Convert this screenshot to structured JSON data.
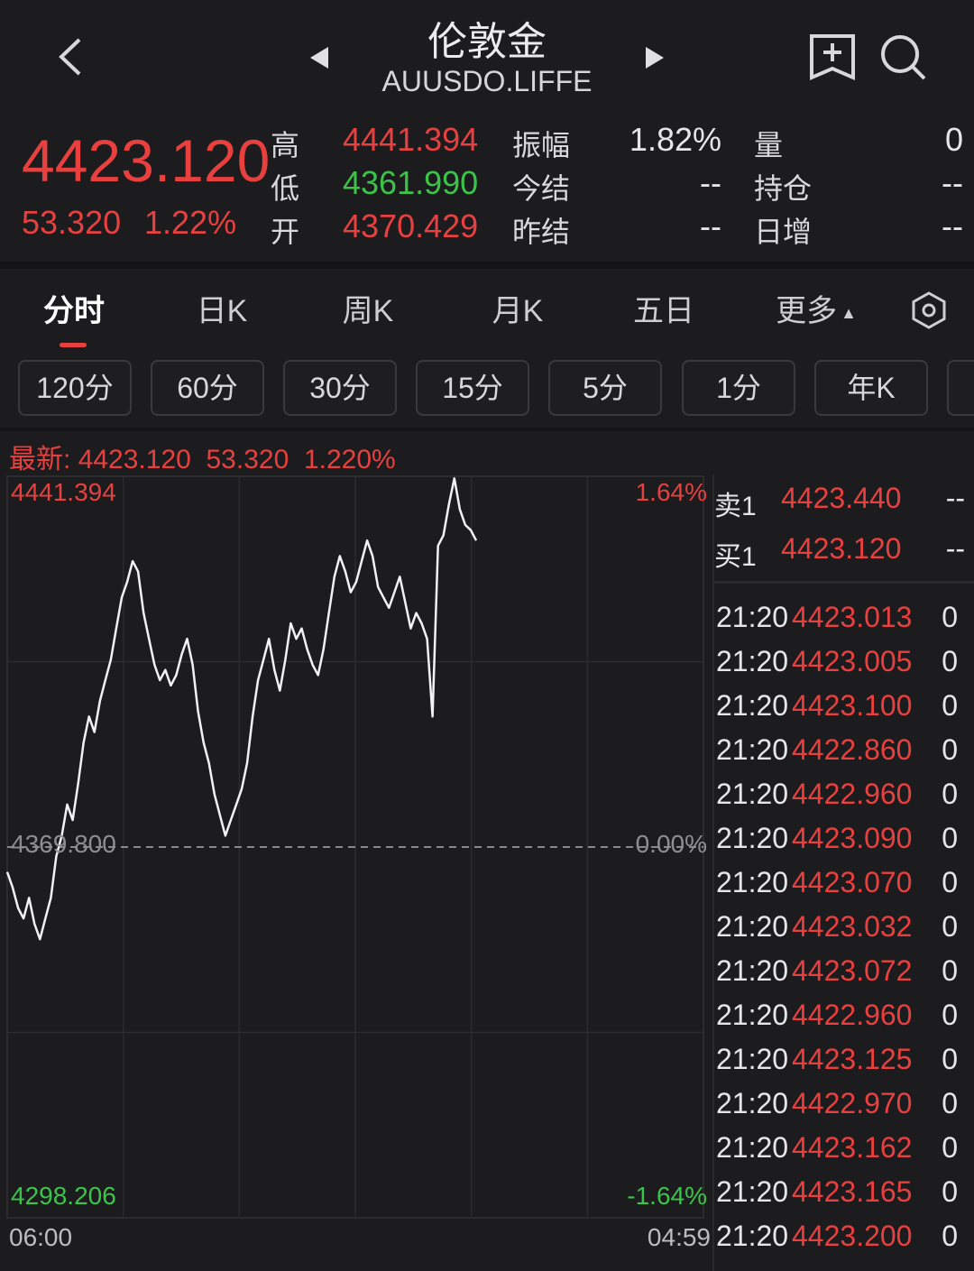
{
  "header": {
    "title": "伦敦金",
    "symbol": "AUUSDO.LIFFE",
    "last_price": "4423.120",
    "change": "53.320",
    "change_pct": "1.22%",
    "stats": {
      "high_label": "高",
      "high": "4441.394",
      "low_label": "低",
      "low": "4361.990",
      "open_label": "开",
      "open": "4370.429",
      "amp_label": "振幅",
      "amp": "1.82%",
      "settle_label": "今结",
      "settle": "--",
      "prev_settle_label": "昨结",
      "prev_settle": "--",
      "vol_label": "量",
      "vol": "0",
      "oi_label": "持仓",
      "oi": "--",
      "daily_inc_label": "日增",
      "daily_inc": "--"
    }
  },
  "tabs": [
    "分时",
    "日K",
    "周K",
    "月K",
    "五日",
    "更多"
  ],
  "active_tab": 0,
  "periods": [
    "120分",
    "60分",
    "30分",
    "15分",
    "5分",
    "1分",
    "年K"
  ],
  "latest_line": {
    "label": "最新:",
    "price": "4423.120",
    "change": "53.320",
    "pct": "1.220%"
  },
  "chart_labels": {
    "top_price": "4441.394",
    "top_pct": "1.64%",
    "mid_price": "4369.800",
    "mid_pct": "0.00%",
    "bottom_price": "4298.206",
    "bottom_pct": "-1.64%",
    "start_time": "06:00",
    "end_time": "04:59"
  },
  "orderbook": {
    "ask_label": "卖1",
    "ask_price": "4423.440",
    "ask_vol": "--",
    "bid_label": "买1",
    "bid_price": "4423.120",
    "bid_vol": "--"
  },
  "ticks": [
    {
      "time": "21:20",
      "price": "4423.013",
      "vol": "0"
    },
    {
      "time": "21:20",
      "price": "4423.005",
      "vol": "0"
    },
    {
      "time": "21:20",
      "price": "4423.100",
      "vol": "0"
    },
    {
      "time": "21:20",
      "price": "4422.860",
      "vol": "0"
    },
    {
      "time": "21:20",
      "price": "4422.960",
      "vol": "0"
    },
    {
      "time": "21:20",
      "price": "4423.090",
      "vol": "0"
    },
    {
      "time": "21:20",
      "price": "4423.070",
      "vol": "0"
    },
    {
      "time": "21:20",
      "price": "4423.032",
      "vol": "0"
    },
    {
      "time": "21:20",
      "price": "4423.072",
      "vol": "0"
    },
    {
      "time": "21:20",
      "price": "4422.960",
      "vol": "0"
    },
    {
      "time": "21:20",
      "price": "4423.125",
      "vol": "0"
    },
    {
      "time": "21:20",
      "price": "4422.970",
      "vol": "0"
    },
    {
      "time": "21:20",
      "price": "4423.162",
      "vol": "0"
    },
    {
      "time": "21:20",
      "price": "4423.165",
      "vol": "0"
    },
    {
      "time": "21:20",
      "price": "4423.200",
      "vol": "0"
    }
  ],
  "chart_data": {
    "type": "line",
    "ylim": [
      4298.206,
      4441.394
    ],
    "baseline": 4369.8,
    "x": [
      "06:00",
      "04:59"
    ],
    "series": [
      {
        "values": [
          4365,
          4362,
          4358,
          4356,
          4360,
          4355,
          4352,
          4356,
          4360,
          4368,
          4372,
          4378,
          4375,
          4382,
          4390,
          4395,
          4392,
          4398,
          4402,
          4406,
          4412,
          4418,
          4421,
          4425,
          4423,
          4415,
          4410,
          4405,
          4402,
          4404,
          4401,
          4403,
          4407,
          4410,
          4405,
          4396,
          4390,
          4386,
          4380,
          4376,
          4372,
          4375,
          4378,
          4381,
          4386,
          4395,
          4402,
          4406,
          4410,
          4404,
          4400,
          4406,
          4413,
          4410,
          4412,
          4408,
          4405,
          4403,
          4408,
          4415,
          4422,
          4426,
          4423,
          4419,
          4421,
          4425,
          4429,
          4426,
          4420,
          4418,
          4416,
          4419,
          4422,
          4417,
          4412,
          4415,
          4413,
          4410,
          4395,
          4428,
          4430,
          4436,
          4441,
          4435,
          4432,
          4431,
          4429
        ]
      }
    ]
  }
}
